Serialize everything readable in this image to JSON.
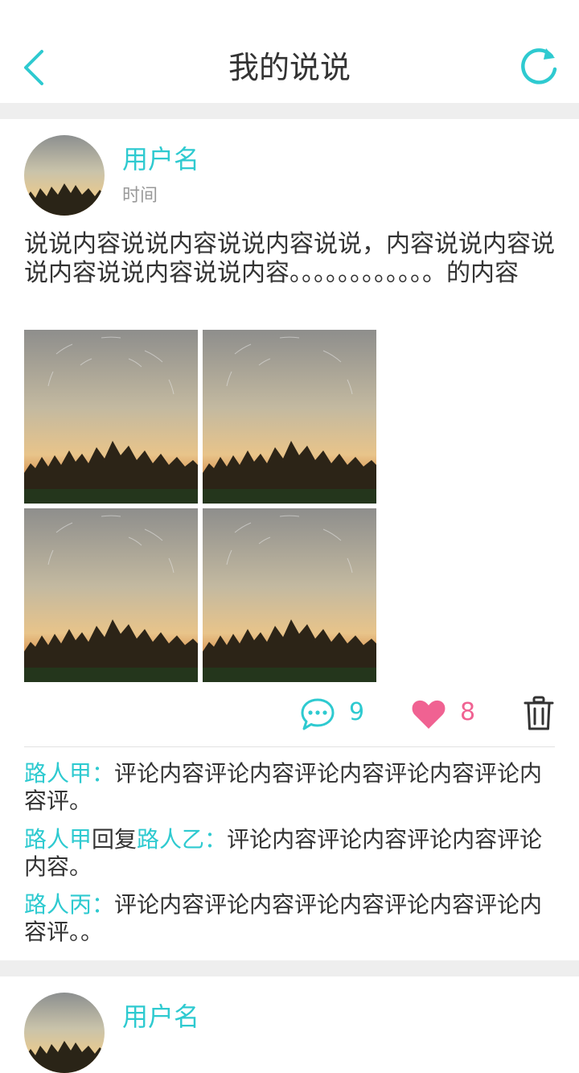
{
  "header": {
    "title": "我的说说",
    "back_icon": "chevron-left-icon",
    "refresh_icon": "refresh-icon"
  },
  "colors": {
    "accent": "#2ecad0",
    "like": "#f06292",
    "text": "#333333",
    "muted": "#999999"
  },
  "posts": [
    {
      "username": "用户名",
      "time": "时间",
      "content": "说说内容说说内容说说内容说说，内容说说内容说说内容说说内容说说内容。。。。。。。。。。。。的内容",
      "comment_count": "9",
      "like_count": "8",
      "comments": [
        {
          "name": "路人甲",
          "separator": "：",
          "text": "评论内容评论内容评论内容评论内容评论内容评。"
        },
        {
          "name": "路人甲",
          "reply_word": "回复",
          "reply_to": "路人乙",
          "separator": "：",
          "text": "评论内容评论内容评论内容评论内容。"
        },
        {
          "name": "路人丙",
          "separator": "：",
          "text": "评论内容评论内容评论内容评论内容评论内容评。。"
        }
      ]
    },
    {
      "username": "用户名"
    }
  ]
}
